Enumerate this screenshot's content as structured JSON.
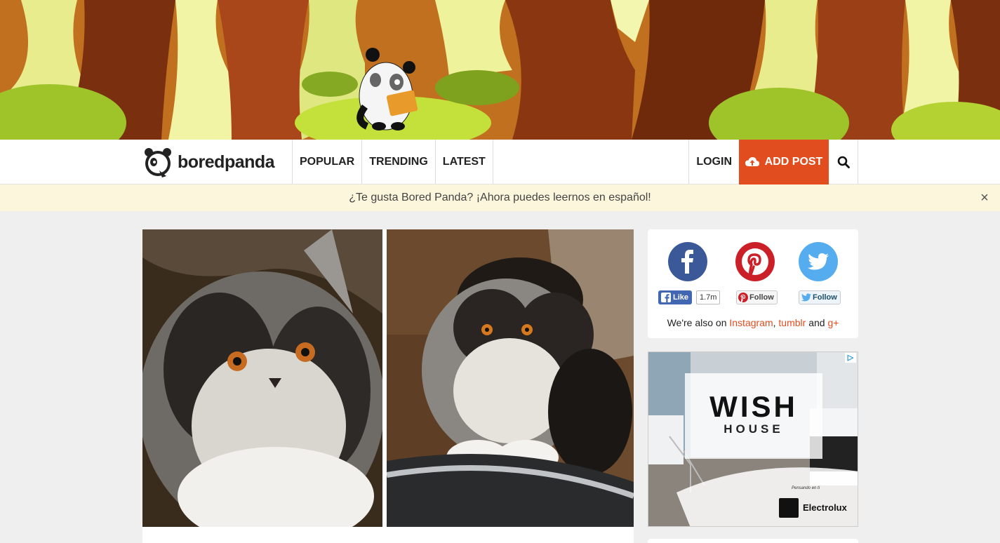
{
  "brand": {
    "name": "boredpanda"
  },
  "nav": {
    "items": [
      "POPULAR",
      "TRENDING",
      "LATEST"
    ],
    "login": "LOGIN",
    "add_post": "ADD POST"
  },
  "notice": {
    "text": "¿Te gusta Bored Panda? ¡Ahora puedes leernos en español!",
    "close": "×"
  },
  "social": {
    "like_label": "Like",
    "like_count": "1.7m",
    "pin_follow": "Follow",
    "tw_follow": "Follow",
    "also_prefix": "We're also on ",
    "instagram": "Instagram",
    "sep": ", ",
    "tumblr": "tumblr",
    "and": " and ",
    "gplus": "g+"
  },
  "ad": {
    "title": "WISH",
    "subtitle": "HOUSE",
    "tagline": "Pensando en ti",
    "brand": "Electrolux",
    "badge": "▷"
  },
  "colors": {
    "accent": "#e24d1f",
    "facebook": "#3b5998",
    "pinterest": "#cb2027",
    "twitter": "#55acee",
    "notice_bg": "#fcf6dc"
  }
}
